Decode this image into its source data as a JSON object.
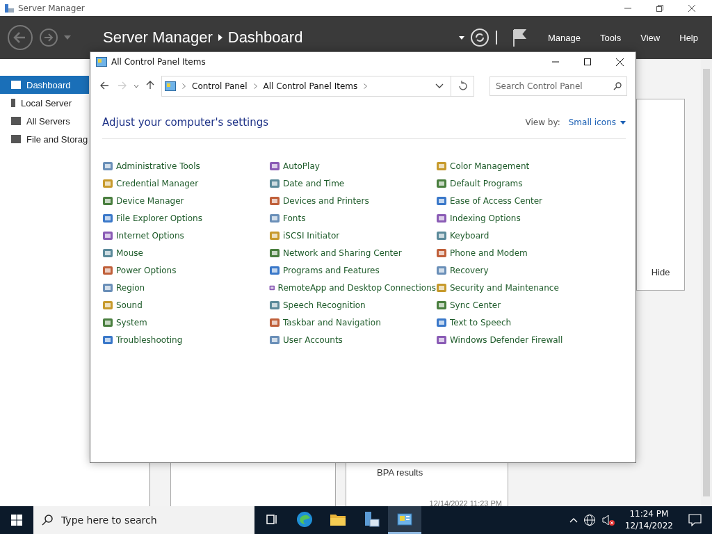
{
  "server_manager": {
    "window_title": "Server Manager",
    "breadcrumb": [
      "Server Manager",
      "Dashboard"
    ],
    "menu": [
      "Manage",
      "Tools",
      "View",
      "Help"
    ],
    "sidebar": [
      {
        "label": "Dashboard",
        "selected": true
      },
      {
        "label": "Local Server",
        "selected": false
      },
      {
        "label": "All Servers",
        "selected": false
      },
      {
        "label": "File and Storag",
        "selected": false
      }
    ],
    "tile_action": "Hide",
    "bpa_label": "BPA results",
    "timestamp": "12/14/2022 11:23 PM"
  },
  "control_panel": {
    "title": "All Control Panel Items",
    "path": [
      "Control Panel",
      "All Control Panel Items"
    ],
    "search": {
      "placeholder": "Search Control Panel"
    },
    "heading": "Adjust your computer's settings",
    "view_by_label": "View by:",
    "view_by_value": "Small icons",
    "items": [
      [
        "Administrative Tools",
        "Credential Manager",
        "Device Manager",
        "File Explorer Options",
        "Internet Options",
        "Mouse",
        "Power Options",
        "Region",
        "Sound",
        "System",
        "Troubleshooting"
      ],
      [
        "AutoPlay",
        "Date and Time",
        "Devices and Printers",
        "Fonts",
        "iSCSI Initiator",
        "Network and Sharing Center",
        "Programs and Features",
        "RemoteApp and Desktop Connections",
        "Speech Recognition",
        "Taskbar and Navigation",
        "User Accounts"
      ],
      [
        "Color Management",
        "Default Programs",
        "Ease of Access Center",
        "Indexing Options",
        "Keyboard",
        "Phone and Modem",
        "Recovery",
        "Security and Maintenance",
        "Sync Center",
        "Text to Speech",
        "Windows Defender Firewall"
      ]
    ]
  },
  "taskbar": {
    "search": {
      "placeholder": "Type here to search"
    },
    "apps": [
      {
        "kind": "taskview",
        "selected": false
      },
      {
        "kind": "edge",
        "selected": false
      },
      {
        "kind": "folder",
        "selected": false
      },
      {
        "kind": "servermanager",
        "selected": false
      },
      {
        "kind": "controlpanel",
        "selected": true
      }
    ],
    "time": "11:24 PM",
    "date": "12/14/2022"
  }
}
